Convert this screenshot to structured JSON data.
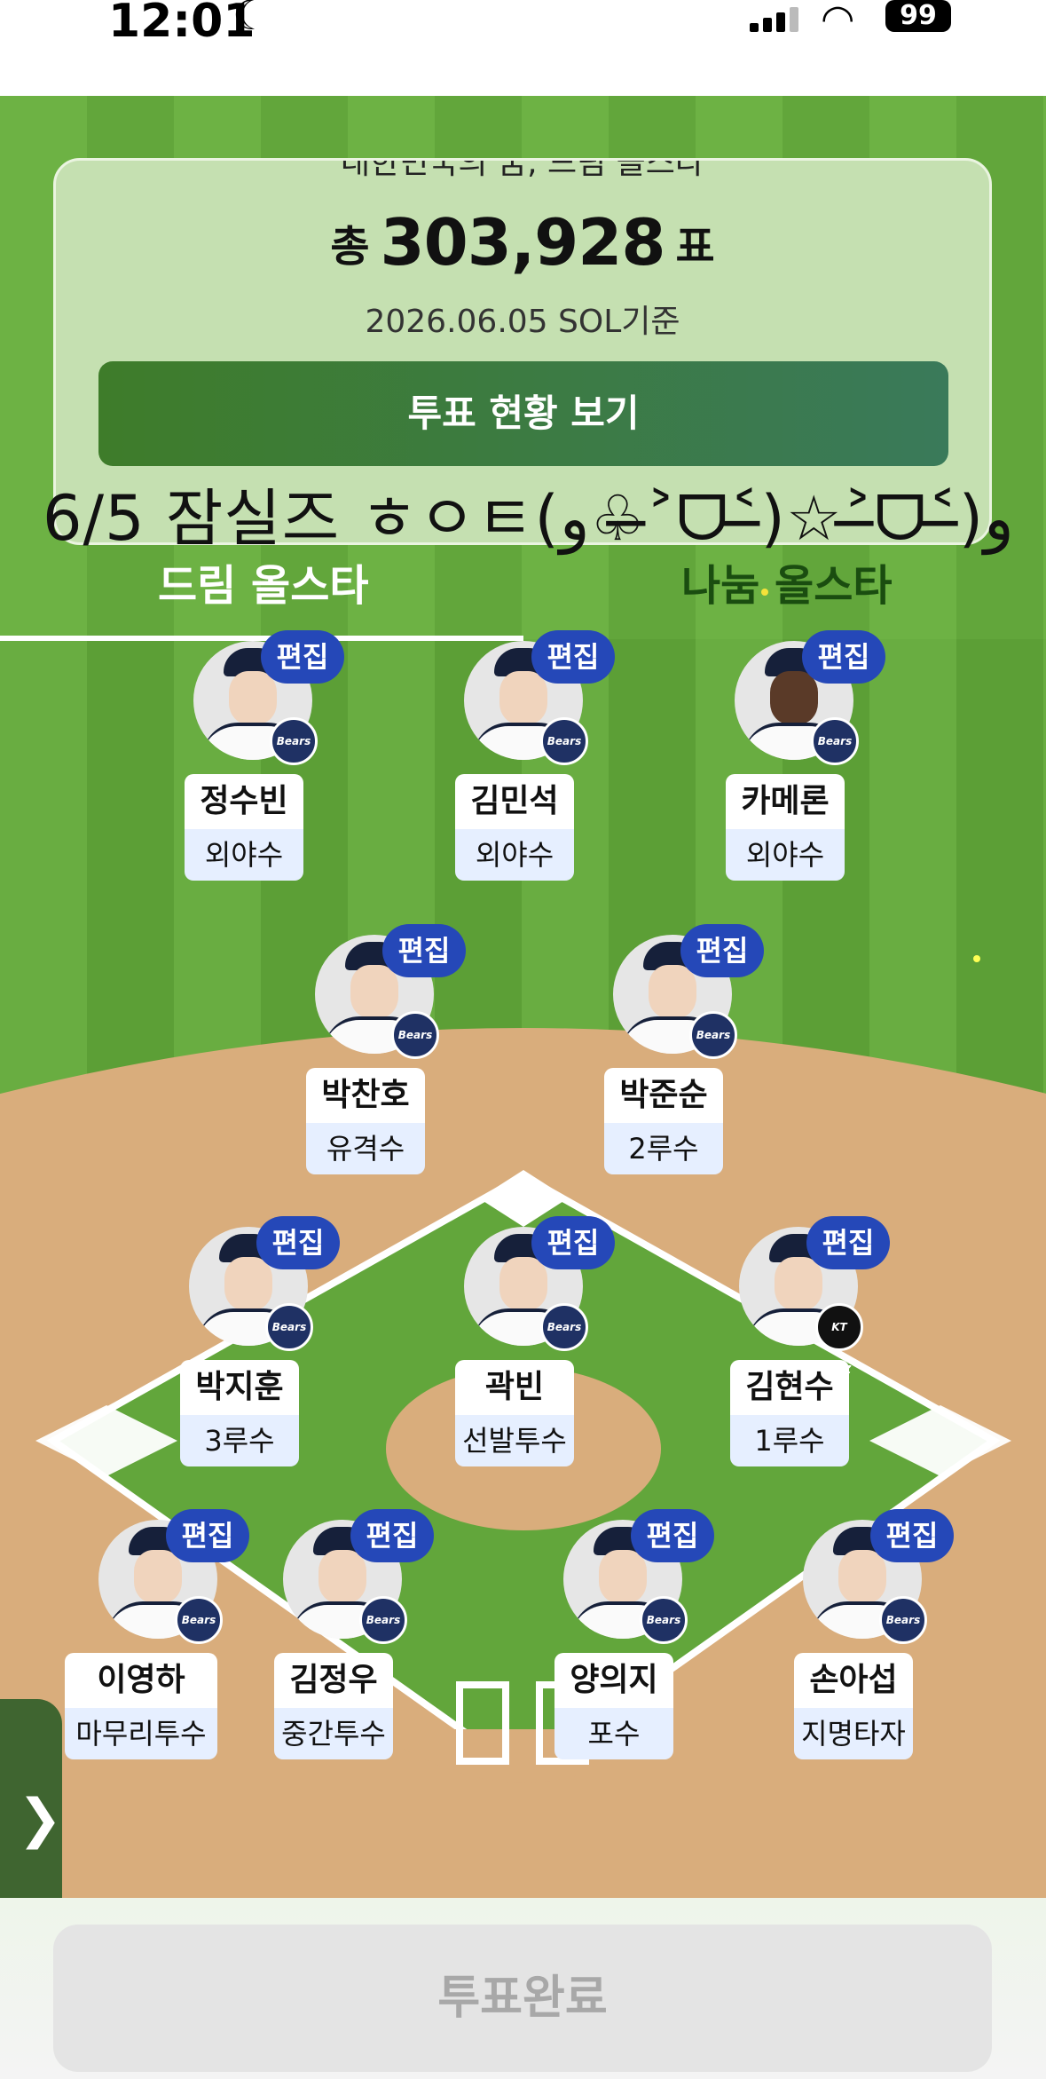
{
  "status_bar": {
    "time": "12:01",
    "battery": "99"
  },
  "vote_card": {
    "cut_text": "대한민국의 꿈, 드림 올스타",
    "total_prefix": "총",
    "total_votes": "303,928",
    "total_suffix": "표",
    "basis_text": "2026.06.05 SOL기준",
    "status_button_label": "투표 현황 보기"
  },
  "banner_text": "6/5 잠실즈 ㅎㅇㅌ(๑ﻭ•̀ᴗ•́)ﻭ✧(๑•̀ᴗ•́)ﻭ",
  "banner_display": "6/5 잠실즈 ㅎㅇㅌ(ﻭ♧˃̶ᗜ˂̶)☆˃̶ᗜ˂̶)ﻭ",
  "tabs": {
    "dream": "드림 올스타",
    "nanum": "나눔 올스타"
  },
  "edit_label": "편집",
  "players": [
    {
      "name": "정수빈",
      "position": "외야수",
      "team": "Bears"
    },
    {
      "name": "김민석",
      "position": "외야수",
      "team": "Bears"
    },
    {
      "name": "카메론",
      "position": "외야수",
      "team": "Bears"
    },
    {
      "name": "박찬호",
      "position": "유격수",
      "team": "Bears"
    },
    {
      "name": "박준순",
      "position": "2루수",
      "team": "Bears"
    },
    {
      "name": "박지훈",
      "position": "3루수",
      "team": "Bears"
    },
    {
      "name": "곽빈",
      "position": "선발투수",
      "team": "Bears"
    },
    {
      "name": "김현수",
      "position": "1루수",
      "team": "KT WIZ"
    },
    {
      "name": "이영하",
      "position": "마무리투수",
      "team": "Bears"
    },
    {
      "name": "김정우",
      "position": "중간투수",
      "team": "Bears"
    },
    {
      "name": "양의지",
      "position": "포수",
      "team": "Bears"
    },
    {
      "name": "손아섭",
      "position": "지명타자",
      "team": "Bears"
    }
  ],
  "side_handle_icon": "chevron-right-icon",
  "done_button_label": "투표완료",
  "colors": {
    "edit_badge": "#2548b8",
    "status_button": "#3e7c2a",
    "field_grass": "#5fa33a",
    "infield_dirt": "#d9ad7c"
  }
}
